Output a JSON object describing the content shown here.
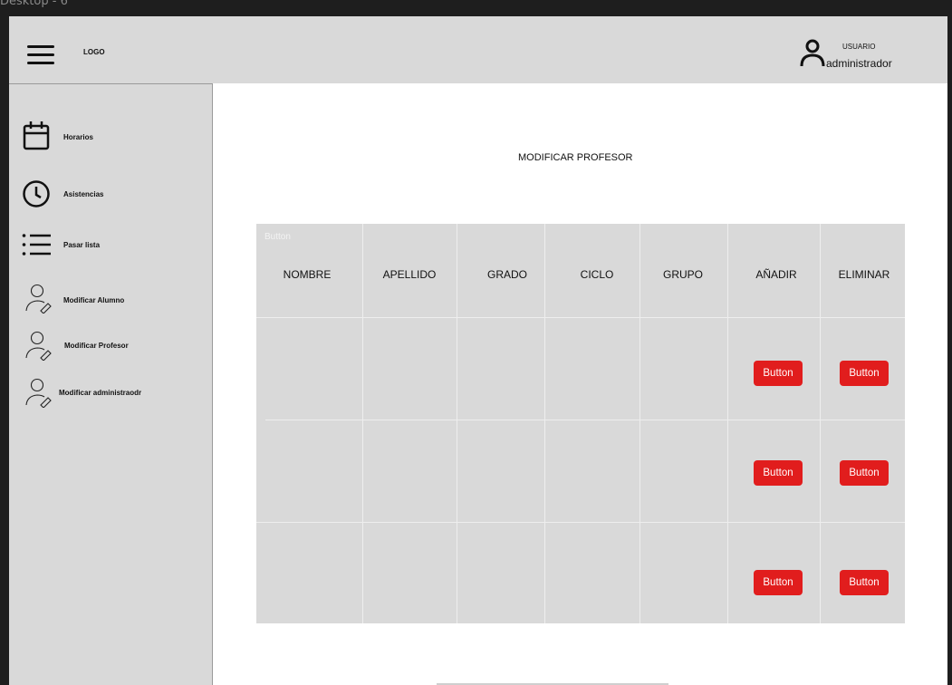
{
  "canvas": {
    "label": "Desktop - 6"
  },
  "header": {
    "logo": "LOGO",
    "user_role": "USUARIO",
    "user_name": "administrador"
  },
  "sidebar": {
    "items": [
      {
        "label": "Horarios",
        "icon": "calendar-icon"
      },
      {
        "label": "Asistencias",
        "icon": "clock-icon"
      },
      {
        "label": "Pasar lista",
        "icon": "list-icon"
      },
      {
        "label": "Modificar Alumno",
        "icon": "user-edit-icon"
      },
      {
        "label": "Modificar Profesor",
        "icon": "user-edit-icon"
      },
      {
        "label": "Modificar administraodr",
        "icon": "user-edit-icon"
      }
    ]
  },
  "main": {
    "title": "MODIFICAR PROFESOR",
    "ghost_button": "Button",
    "columns": [
      "NOMBRE",
      "APELLIDO",
      "GRADO",
      "CICLO",
      "GRUPO",
      "AÑADIR",
      "ELIMINAR"
    ],
    "rows": [
      {
        "add_label": "Button",
        "delete_label": "Button"
      },
      {
        "add_label": "Button",
        "delete_label": "Button"
      },
      {
        "add_label": "Button",
        "delete_label": "Button"
      }
    ]
  },
  "colors": {
    "panel": "#d9d9d9",
    "danger": "#e11d1d",
    "canvas": "#1e1e1e"
  }
}
